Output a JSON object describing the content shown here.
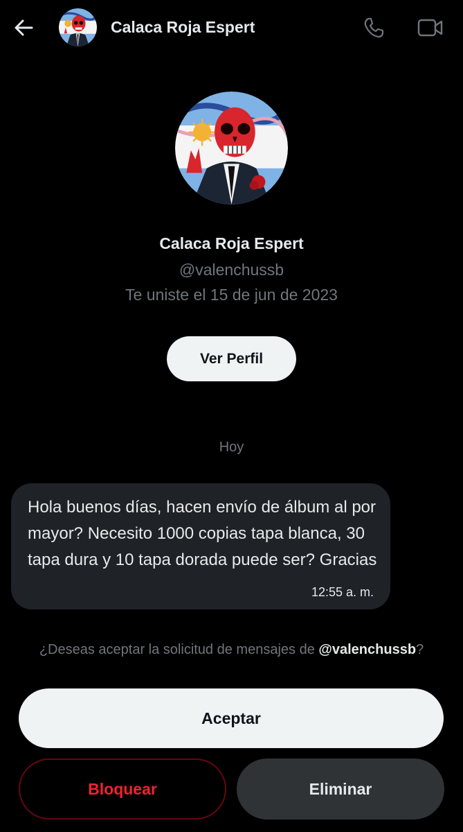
{
  "header": {
    "title": "Calaca Roja Espert",
    "back_icon": "arrow-left-icon",
    "call_icon": "phone-icon",
    "video_icon": "video-camera-icon"
  },
  "profile": {
    "name": "Calaca Roja Espert",
    "handle": "@valenchussb",
    "joined": "Te uniste el 15 de jun de 2023",
    "view_profile_label": "Ver Perfil"
  },
  "conversation": {
    "date_separator": "Hoy",
    "messages": [
      {
        "text": "Hola buenos días, hacen envío de álbum al por mayor? Necesito 1000 copias tapa blanca, 30 tapa dura y 10 tapa dorada puede ser? Gracias",
        "time": "12:55 a. m."
      }
    ]
  },
  "request": {
    "prompt_prefix": "¿Deseas aceptar la solicitud de mensajes de ",
    "prompt_handle": "@valenchussb",
    "prompt_suffix": "?",
    "accept_label": "Aceptar",
    "block_label": "Bloquear",
    "delete_label": "Eliminar"
  },
  "colors": {
    "background": "#000000",
    "text_primary": "#e7e9ea",
    "text_secondary": "#71767b",
    "bubble": "#1f2226",
    "danger": "#f4212e",
    "button_light": "#eff3f4",
    "button_dark": "#2f3336"
  }
}
